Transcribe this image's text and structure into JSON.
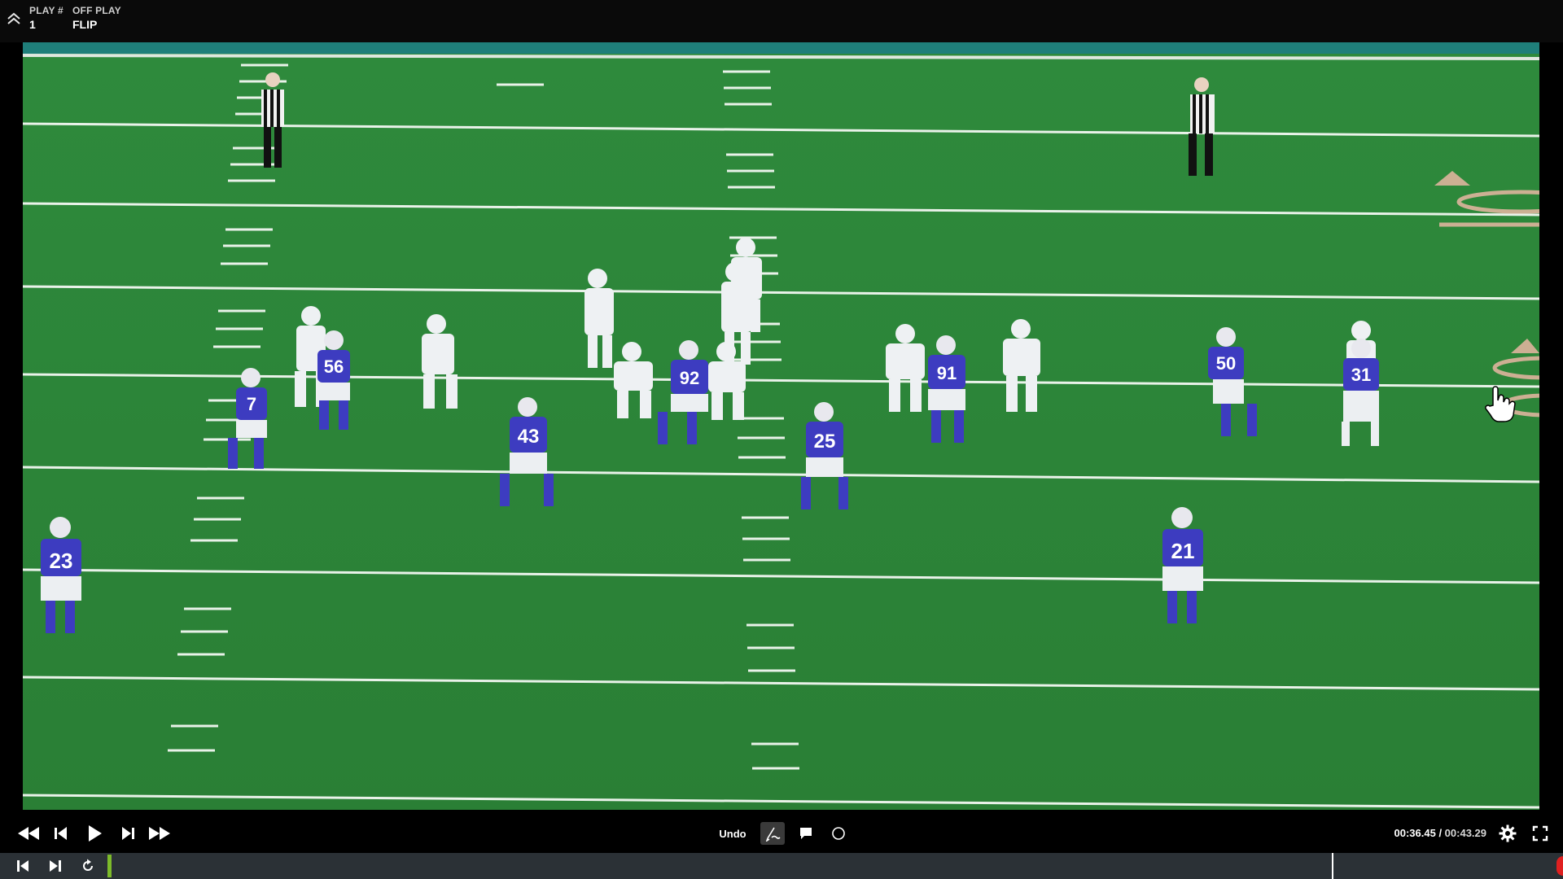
{
  "header": {
    "play_number_label": "PLAY #",
    "play_number_value": "1",
    "off_play_label": "OFF PLAY",
    "off_play_value": "FLIP"
  },
  "video": {
    "field_color": "#2f8a3a",
    "defense_jersey_color": "#3d3cc0",
    "offense_jersey_color": "#eef1f3",
    "defense_numbers": [
      "7",
      "56",
      "92",
      "91",
      "50",
      "31",
      "43",
      "25",
      "23",
      "21"
    ]
  },
  "controls": {
    "undo_label": "Undo",
    "time_current": "00:36.45",
    "time_separator": " / ",
    "time_total": "00:43.29",
    "progress_fraction": 0.8414
  },
  "icons": {
    "collapse": "double-chevron-up-icon",
    "rewind": "rewind-icon",
    "step_back": "step-back-icon",
    "play": "play-icon",
    "step_forward": "step-forward-icon",
    "fast_forward": "fast-forward-icon",
    "draw": "draw-pen-icon",
    "comment": "comment-icon",
    "circle": "circle-icon",
    "settings": "gear-icon",
    "fullscreen": "fullscreen-icon",
    "skip_start": "skip-to-start-icon",
    "skip_end": "skip-to-end-icon",
    "replay": "replay-icon"
  }
}
